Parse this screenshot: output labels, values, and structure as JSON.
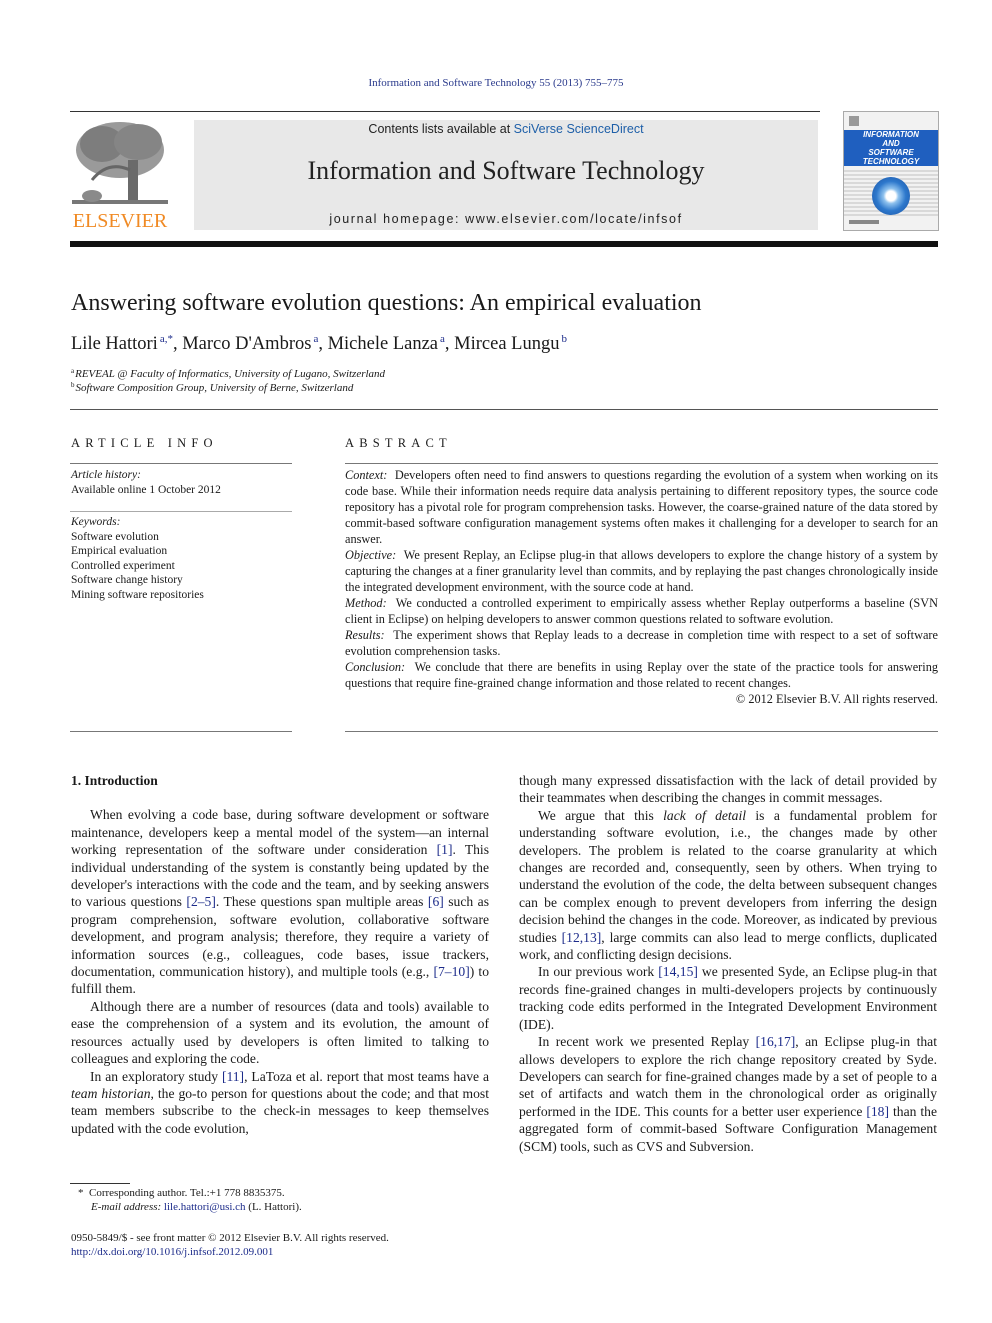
{
  "journal_citation": "Information and Software Technology 55 (2013) 755–775",
  "masthead": {
    "publisher_wordmark": "ELSEVIER",
    "contents_prefix": "Contents lists available at ",
    "contents_link": "SciVerse ScienceDirect",
    "journal_title": "Information and Software Technology",
    "homepage": "journal homepage: www.elsevier.com/locate/infsof",
    "cover_lines": [
      "INFORMATION",
      "AND",
      "SOFTWARE",
      "TECHNOLOGY"
    ],
    "colors": {
      "elsevier_orange": "#f08a24",
      "link_blue": "#1e5fa8",
      "cover_blue": "#1f5fbf"
    }
  },
  "article": {
    "title": "Answering software evolution questions: An empirical evaluation",
    "authors": [
      {
        "name": "Lile Hattori",
        "sup": "a,*"
      },
      {
        "name": "Marco D'Ambros",
        "sup": "a"
      },
      {
        "name": "Michele Lanza",
        "sup": "a"
      },
      {
        "name": "Mircea Lungu",
        "sup": "b"
      }
    ],
    "affiliations": [
      {
        "key": "a",
        "text": "REVEAL @ Faculty of Informatics, University of Lugano, Switzerland"
      },
      {
        "key": "b",
        "text": "Software Composition Group, University of Berne, Switzerland"
      }
    ]
  },
  "article_info": {
    "heading": "ARTICLE INFO",
    "history_label": "Article history:",
    "history_value": "Available online 1 October 2012",
    "keywords_label": "Keywords:",
    "keywords": [
      "Software evolution",
      "Empirical evaluation",
      "Controlled experiment",
      "Software change history",
      "Mining software repositories"
    ]
  },
  "abstract": {
    "heading": "ABSTRACT",
    "sections": [
      {
        "label": "Context:",
        "text": "Developers often need to find answers to questions regarding the evolution of a system when working on its code base. While their information needs require data analysis pertaining to different repository types, the source code repository has a pivotal role for program comprehension tasks. However, the coarse-grained nature of the data stored by commit-based software configuration management systems often makes it challenging for a developer to search for an answer."
      },
      {
        "label": "Objective:",
        "text": "We present Replay, an Eclipse plug-in that allows developers to explore the change history of a system by capturing the changes at a finer granularity level than commits, and by replaying the past changes chronologically inside the integrated development environment, with the source code at hand."
      },
      {
        "label": "Method:",
        "text": "We conducted a controlled experiment to empirically assess whether Replay outperforms a baseline (SVN client in Eclipse) on helping developers to answer common questions related to software evolution."
      },
      {
        "label": "Results:",
        "text": "The experiment shows that Replay leads to a decrease in completion time with respect to a set of software evolution comprehension tasks."
      },
      {
        "label": "Conclusion:",
        "text": "We conclude that there are benefits in using Replay over the state of the practice tools for answering questions that require fine-grained change information and those related to recent changes."
      }
    ],
    "copyright": "© 2012 Elsevier B.V. All rights reserved."
  },
  "body": {
    "section_heading": "1. Introduction",
    "p1": {
      "t1": "When evolving a code base, during software development or software maintenance, developers keep a mental model of the system—an internal working representation of the software under consideration ",
      "r1": "[1]",
      "t2": ". This individual understanding of the system is constantly being updated by the developer's interactions with the code and the team, and by seeking answers to various questions ",
      "r2": "[2–5]",
      "t3": ". These questions span multiple areas ",
      "r3": "[6]",
      "t4": " such as program comprehension, software evolution, collaborative software development, and program analysis; therefore, they require a variety of information sources (e.g., colleagues, code bases, issue trackers, documentation, communication history), and multiple tools (e.g., ",
      "r4": "[7–10]",
      "t5": ") to fulfill them."
    },
    "p2": "Although there are a number of resources (data and tools) available to ease the comprehension of a system and its evolution, the amount of resources actually used by developers is often limited to talking to colleagues and exploring the code.",
    "p3": {
      "t1": "In an exploratory study ",
      "r1": "[11]",
      "t2": ", LaToza et al. report that most teams have a ",
      "em": "team historian",
      "t3": ", the go-to person for questions about the code; and that most team members subscribe to the check-in messages to keep themselves updated with the code evolution, "
    },
    "p3_cont": "though many expressed dissatisfaction with the lack of detail provided by their teammates when describing the changes in commit messages.",
    "p4": {
      "t1": "We argue that this ",
      "em": "lack of detail",
      "t2": " is a fundamental problem for understanding software evolution, i.e., the changes made by other developers. The problem is related to the coarse granularity at which changes are recorded and, consequently, seen by others. When trying to understand the evolution of the code, the delta between subsequent changes can be complex enough to prevent developers from inferring the design decision behind the changes in the code. Moreover, as indicated by previous studies ",
      "r1": "[12,13]",
      "t3": ", large commits can also lead to merge conflicts, duplicated work, and conflicting design decisions."
    },
    "p5": {
      "t1": "In our previous work ",
      "r1": "[14,15]",
      "t2": " we presented Syde, an Eclipse plug-in that records fine-grained changes in multi-developers projects by continuously tracking code edits performed in the Integrated Development Environment (IDE)."
    },
    "p6": {
      "t1": "In recent work we presented Replay ",
      "r1": "[16,17]",
      "t2": ", an Eclipse plug-in that allows developers to explore the rich change repository created by Syde. Developers can search for fine-grained changes made by a set of people to a set of artifacts and watch them in the chronological order as originally performed in the IDE. This counts for a better user experience ",
      "r2": "[18]",
      "t3": " than the aggregated form of commit-based Software Configuration Management (SCM) tools, such as CVS and Subversion."
    }
  },
  "footnote": {
    "marker": "*",
    "corresponding": "Corresponding author. Tel.:+1 778 8835375.",
    "email_label": "E-mail address: ",
    "email": "lile.hattori@usi.ch",
    "email_suffix": " (L. Hattori)."
  },
  "front_matter": {
    "issn_line": "0950-5849/$ - see front matter © 2012 Elsevier B.V. All rights reserved.",
    "doi": "http://dx.doi.org/10.1016/j.infsof.2012.09.001"
  }
}
